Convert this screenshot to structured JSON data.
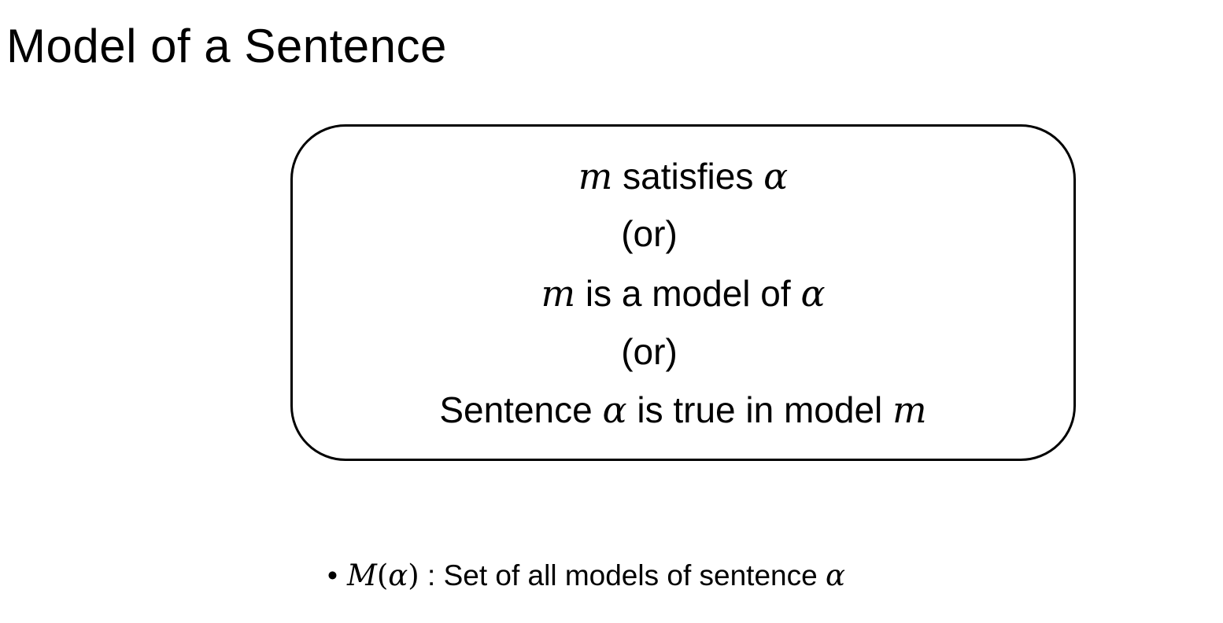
{
  "slide": {
    "title": "Model of a Sentence"
  },
  "definition": {
    "line1": {
      "var1": "m",
      "text": " satisfies ",
      "var2": "α"
    },
    "line2": {
      "text": "(or)"
    },
    "line3": {
      "var1": "m",
      "text": " is a model of ",
      "var2": "α"
    },
    "line4": {
      "text": "(or)"
    },
    "line5": {
      "text1": "Sentence ",
      "var1": "α",
      "text2": " is true in model ",
      "var2": "m"
    }
  },
  "bullets": [
    {
      "marker": "•",
      "func": "M",
      "open": "(",
      "arg": "α",
      "close": ")",
      "text": " : Set of all models of sentence ",
      "var": "α"
    }
  ]
}
